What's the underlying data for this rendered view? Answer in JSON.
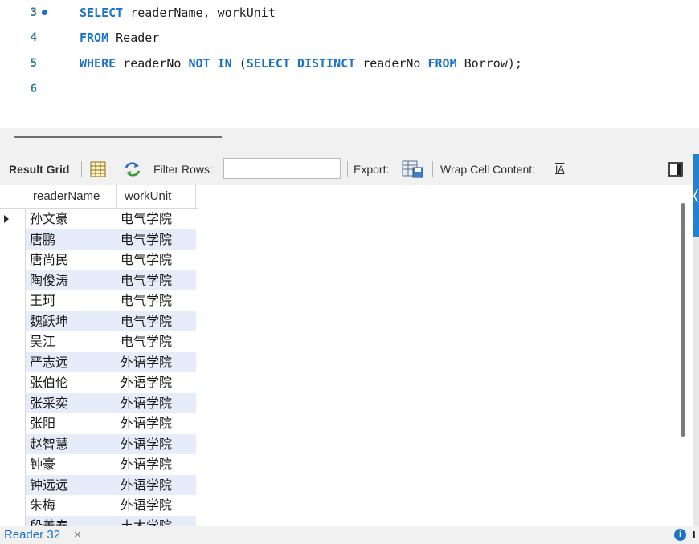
{
  "editor": {
    "lines": [
      {
        "no": "3",
        "tokens": [
          {
            "text": "SELECT",
            "kw": true
          },
          {
            "text": " readerName, workUnit",
            "kw": false
          }
        ]
      },
      {
        "no": "4",
        "tokens": [
          {
            "text": "FROM",
            "kw": true
          },
          {
            "text": " Reader",
            "kw": false
          }
        ]
      },
      {
        "no": "5",
        "tokens": [
          {
            "text": "WHERE",
            "kw": true
          },
          {
            "text": " readerNo ",
            "kw": false
          },
          {
            "text": "NOT IN",
            "kw": true
          },
          {
            "text": " (",
            "kw": false
          },
          {
            "text": "SELECT DISTINCT",
            "kw": true
          },
          {
            "text": " readerNo ",
            "kw": false
          },
          {
            "text": "FROM",
            "kw": true
          },
          {
            "text": " Borrow);",
            "kw": false
          }
        ]
      },
      {
        "no": "6",
        "tokens": []
      }
    ]
  },
  "toolbar": {
    "result_grid_label": "Result Grid",
    "filter_rows_label": "Filter Rows:",
    "filter_value": "",
    "export_label": "Export:",
    "wrap_label": "Wrap Cell Content:",
    "wrap_icon_text": "IA"
  },
  "grid": {
    "columns": [
      "readerName",
      "workUnit"
    ],
    "rows": [
      [
        "孙文豪",
        "电气学院"
      ],
      [
        "唐鹏",
        "电气学院"
      ],
      [
        "唐尚民",
        "电气学院"
      ],
      [
        "陶俊涛",
        "电气学院"
      ],
      [
        "王珂",
        "电气学院"
      ],
      [
        "魏跃坤",
        "电气学院"
      ],
      [
        "吴江",
        "电气学院"
      ],
      [
        "严志远",
        "外语学院"
      ],
      [
        "张伯伦",
        "外语学院"
      ],
      [
        "张采奕",
        "外语学院"
      ],
      [
        "张阳",
        "外语学院"
      ],
      [
        "赵智慧",
        "外语学院"
      ],
      [
        "钟豪",
        "外语学院"
      ],
      [
        "钟远远",
        "外语学院"
      ],
      [
        "朱梅",
        "外语学院"
      ],
      [
        "段善春",
        "土木学院"
      ]
    ],
    "selected_row": 0
  },
  "tabbar": {
    "tab_label": "Reader 32",
    "close_glyph": "×",
    "info_glyph": "i",
    "info_tail": "I"
  },
  "colors": {
    "keyword": "#1a73c9",
    "alt_row": "#e6ecfa",
    "accent": "#1f82d2"
  }
}
